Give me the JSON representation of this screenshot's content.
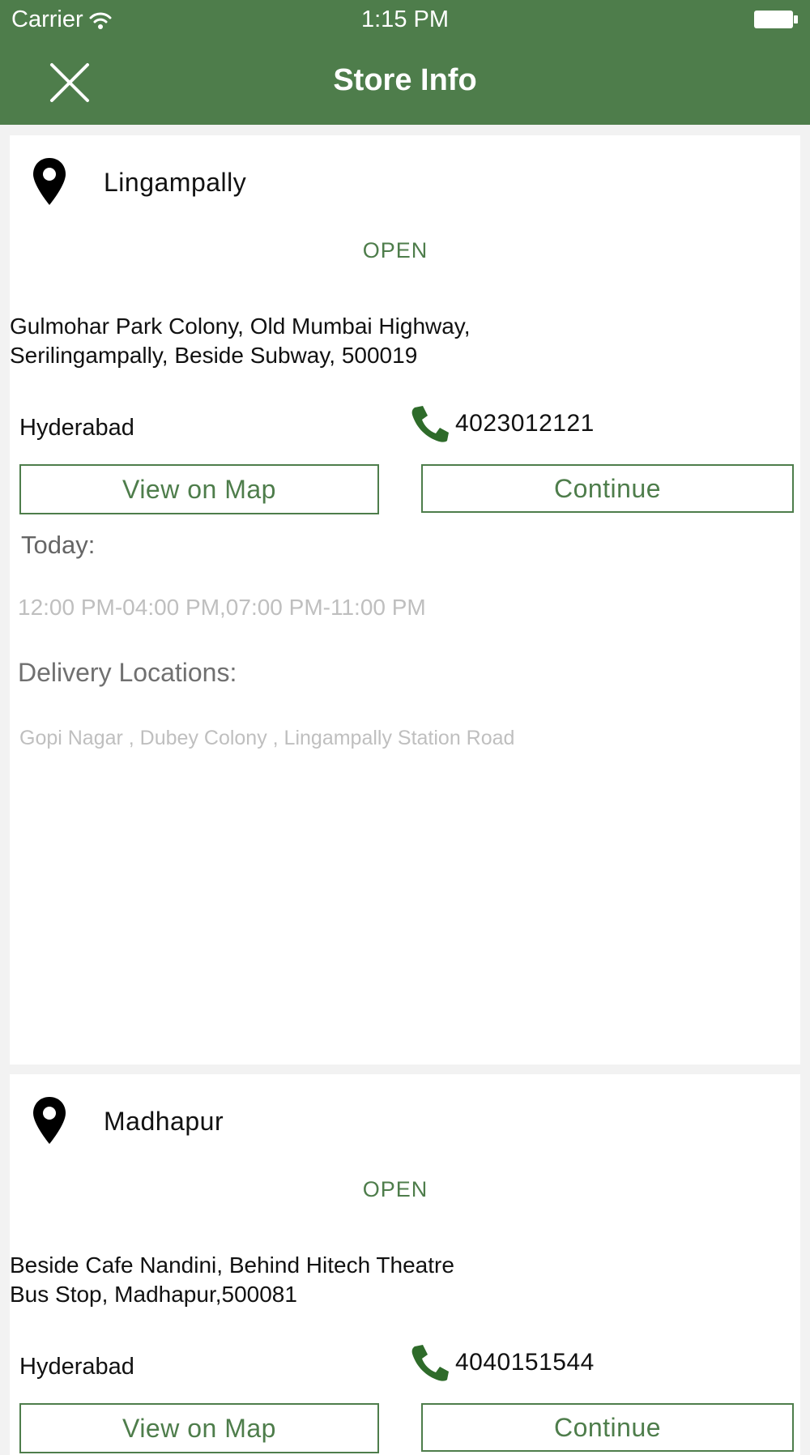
{
  "status_bar": {
    "carrier": "Carrier",
    "time": "1:15 PM",
    "wifi_icon": "wifi-icon",
    "battery_icon": "battery-icon"
  },
  "header": {
    "title": "Store Info",
    "close_icon": "close-icon",
    "background_color": "#4e7d4b"
  },
  "stores": [
    {
      "name": "Lingampally",
      "status": "OPEN",
      "address": "Gulmohar Park Colony, Old Mumbai Highway,\nSerilingampally, Beside Subway, 500019",
      "city": "Hyderabad",
      "phone": "4023012121",
      "view_map_label": "View on Map",
      "continue_label": "Continue",
      "today_label": "Today:",
      "hours": "12:00 PM-04:00 PM,07:00 PM-11:00 PM",
      "delivery_label": "Delivery Locations:",
      "delivery_areas": "Gopi Nagar , Dubey Colony , Lingampally Station Road"
    },
    {
      "name": "Madhapur",
      "status": "OPEN",
      "address": " Beside Cafe Nandini, Behind Hitech Theatre\nBus Stop, Madhapur,500081",
      "city": "Hyderabad",
      "phone": "4040151544",
      "view_map_label": "View on Map",
      "continue_label": "Continue"
    }
  ],
  "colors": {
    "accent": "#4e7d4b",
    "muted_text": "#bfbfbf",
    "label_text": "#707070"
  }
}
